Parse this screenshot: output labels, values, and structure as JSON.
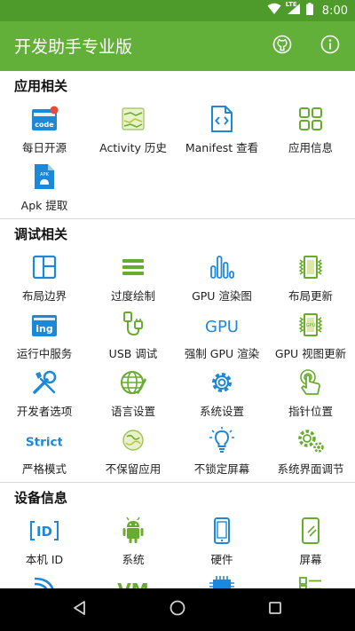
{
  "status": {
    "lte": "LTE",
    "time": "8:00"
  },
  "app": {
    "title": "开发助手专业版"
  },
  "colors": {
    "accent": "#62b03a",
    "status_bar": "#4e9a2a",
    "icon_blue": "#1e88d8",
    "icon_green": "#67ac2d",
    "badge": "#e84b3c"
  },
  "sections": [
    {
      "title": "应用相关",
      "items": [
        {
          "label": "每日开源",
          "icon": "code-box-icon",
          "badge_text": "code"
        },
        {
          "label": "Activity 历史",
          "icon": "activity-history-icon"
        },
        {
          "label": "Manifest 查看",
          "icon": "manifest-file-icon"
        },
        {
          "label": "应用信息",
          "icon": "app-grid-icon"
        },
        {
          "label": "Apk 提取",
          "icon": "apk-file-icon",
          "badge_text": "APK"
        }
      ]
    },
    {
      "title": "调试相关",
      "items": [
        {
          "label": "布局边界",
          "icon": "layout-bounds-icon"
        },
        {
          "label": "过度绘制",
          "icon": "overdraw-icon"
        },
        {
          "label": "GPU 渲染图",
          "icon": "gpu-bars-icon"
        },
        {
          "label": "布局更新",
          "icon": "layout-update-icon"
        },
        {
          "label": "运行中服务",
          "icon": "running-service-icon",
          "badge_text": "ing"
        },
        {
          "label": "USB 调试",
          "icon": "usb-cable-icon"
        },
        {
          "label": "强制 GPU 渲染",
          "icon": "gpu-text-icon",
          "badge_text": "GPU"
        },
        {
          "label": "GPU 视图更新",
          "icon": "gpu-view-update-icon"
        },
        {
          "label": "开发者选项",
          "icon": "developer-tools-icon"
        },
        {
          "label": "语言设置",
          "icon": "language-globe-icon"
        },
        {
          "label": "系统设置",
          "icon": "settings-gear-icon"
        },
        {
          "label": "指针位置",
          "icon": "pointer-touch-icon"
        },
        {
          "label": "严格模式",
          "icon": "strict-mode-icon",
          "badge_text": "Strict"
        },
        {
          "label": "不保留应用",
          "icon": "dont-keep-apps-icon"
        },
        {
          "label": "不锁定屏幕",
          "icon": "lightbulb-icon"
        },
        {
          "label": "系统界面调节",
          "icon": "system-ui-gears-icon"
        }
      ]
    },
    {
      "title": "设备信息",
      "items": [
        {
          "label": "本机 ID",
          "icon": "device-id-icon",
          "badge_text": "ID"
        },
        {
          "label": "系统",
          "icon": "android-robot-icon"
        },
        {
          "label": "硬件",
          "icon": "phone-hardware-icon"
        },
        {
          "label": "屏幕",
          "icon": "screen-icon"
        },
        {
          "label": "",
          "icon": "network-wifi-icon"
        },
        {
          "label": "",
          "icon": "virtual-machine-icon",
          "badge_text": "VM"
        },
        {
          "label": "",
          "icon": "cpu-chip-icon"
        },
        {
          "label": "",
          "icon": "feature-list-icon"
        }
      ]
    }
  ]
}
